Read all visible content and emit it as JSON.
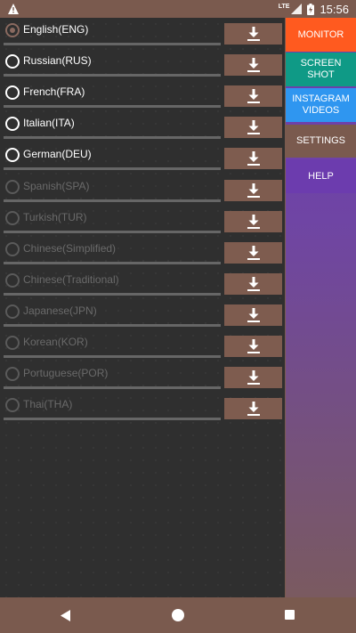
{
  "status_bar": {
    "time": "15:56",
    "network": "LTE"
  },
  "languages": [
    {
      "label": "English(ENG)",
      "selected": true,
      "enabled": true
    },
    {
      "label": "Russian(RUS)",
      "selected": false,
      "enabled": true
    },
    {
      "label": "French(FRA)",
      "selected": false,
      "enabled": true
    },
    {
      "label": "Italian(ITA)",
      "selected": false,
      "enabled": true
    },
    {
      "label": "German(DEU)",
      "selected": false,
      "enabled": true
    },
    {
      "label": "Spanish(SPA)",
      "selected": false,
      "enabled": false
    },
    {
      "label": "Turkish(TUR)",
      "selected": false,
      "enabled": false
    },
    {
      "label": "Chinese(Simplified)",
      "selected": false,
      "enabled": false
    },
    {
      "label": "Chinese(Traditional)",
      "selected": false,
      "enabled": false
    },
    {
      "label": "Japanese(JPN)",
      "selected": false,
      "enabled": false
    },
    {
      "label": "Korean(KOR)",
      "selected": false,
      "enabled": false
    },
    {
      "label": "Portuguese(POR)",
      "selected": false,
      "enabled": false
    },
    {
      "label": "Thai(THA)",
      "selected": false,
      "enabled": false
    }
  ],
  "menu": {
    "monitor": "MONITOR",
    "screenshot": "SCREEN SHOT",
    "instagram": "INSTAGRAM VIDEOS",
    "settings": "SETTINGS",
    "help": "HELP"
  },
  "colors": {
    "accent_brown": "#7a5a4e",
    "monitor": "#ff5a1f",
    "screenshot": "#0f9a86",
    "instagram": "#2f96f0",
    "help_purple": "#6c3cae"
  }
}
